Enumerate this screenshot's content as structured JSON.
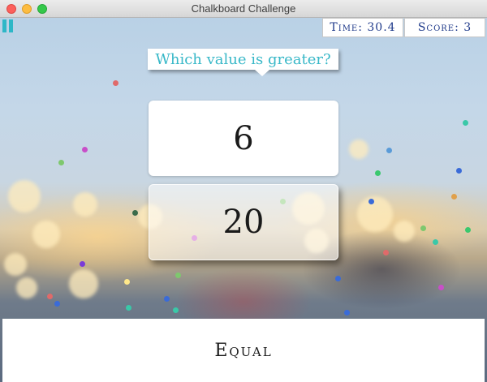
{
  "window": {
    "title": "Chalkboard Challenge"
  },
  "hud": {
    "time_label": "Time: 30.4",
    "score_label": "Score: 3"
  },
  "question": {
    "text": "Which value is greater?"
  },
  "choices": {
    "top_value": "6",
    "bottom_value": "20",
    "equal_label": "Equal"
  },
  "colors": {
    "accent": "#2db7c7",
    "hud_text": "#1f3a8a"
  }
}
